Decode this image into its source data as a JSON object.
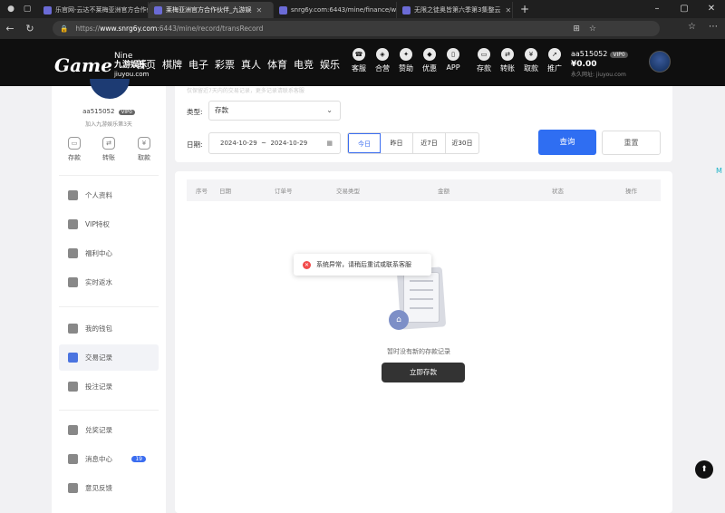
{
  "browser": {
    "tabs": [
      {
        "title": "乐官网-云达不莱梅亚洲官方合作伙"
      },
      {
        "title": "莱梅亚洲官方合作伙伴_九游娱"
      },
      {
        "title": "snrg6y.com:6443/mine/finance/w"
      },
      {
        "title": "无限之徒奥皆第六季第3集整云"
      }
    ],
    "url_prefix": "https://",
    "url_host": "www.snrg6y.com",
    "url_path": ":6443/mine/record/transRecord"
  },
  "header": {
    "logo_main": "Game",
    "logo_top": "Nine",
    "logo_cn": "九游娱乐",
    "logo_domain": "jiuyou.com",
    "nav": [
      "首页",
      "棋牌",
      "电子",
      "彩票",
      "真人",
      "体育",
      "电竞",
      "娱乐"
    ],
    "icons": [
      {
        "label": "客服",
        "icon": "headset-icon"
      },
      {
        "label": "合营",
        "icon": "partner-icon"
      },
      {
        "label": "赞助",
        "icon": "sponsor-icon"
      },
      {
        "label": "优惠",
        "icon": "gift-icon"
      },
      {
        "label": "APP",
        "icon": "phone-icon"
      },
      {
        "label": "存款",
        "icon": "wallet-icon"
      },
      {
        "label": "转账",
        "icon": "transfer-icon"
      },
      {
        "label": "取款",
        "icon": "withdraw-icon"
      },
      {
        "label": "推广",
        "icon": "promote-icon"
      }
    ],
    "username": "aa515052",
    "vip": "VIP0",
    "balance": "¥0.00",
    "permanent_site": "永久网址: jiuyou.com"
  },
  "sidebar": {
    "username": "aa515052",
    "vip": "VIP0",
    "joined": "加入九游娱乐第3天",
    "quick": [
      "存款",
      "转账",
      "取款"
    ],
    "items": [
      {
        "label": "个人资料",
        "icon": "profile-icon"
      },
      {
        "label": "VIP特权",
        "icon": "vip-icon"
      },
      {
        "label": "福利中心",
        "icon": "gift-icon"
      },
      {
        "label": "实时返水",
        "icon": "rebate-icon"
      },
      {
        "label": "我的钱包",
        "icon": "wallet-icon"
      },
      {
        "label": "交易记录",
        "icon": "transaction-icon"
      },
      {
        "label": "投注记录",
        "icon": "bet-record-icon"
      },
      {
        "label": "兑奖记录",
        "icon": "prize-icon"
      },
      {
        "label": "消息中心",
        "icon": "message-icon",
        "badge": "19"
      },
      {
        "label": "意见反馈",
        "icon": "feedback-icon"
      }
    ],
    "active_item": "交易记录"
  },
  "filters": {
    "faint_note": "仅保留近7天内的交易记录，更多记录请联系客服",
    "type_label": "类型:",
    "type_value": "存款",
    "date_label": "日期:",
    "date_start": "2024-10-29",
    "date_sep": "~",
    "date_end": "2024-10-29",
    "quick_ranges": [
      "今日",
      "昨日",
      "近7日",
      "近30日"
    ],
    "active_range": "今日",
    "query_label": "查询",
    "reset_label": "重置"
  },
  "table": {
    "columns": [
      "序号",
      "日期",
      "订单号",
      "交易类型",
      "金额",
      "状态",
      "操作"
    ]
  },
  "toast": {
    "message": "系统异常，请稍后重试或联系客服"
  },
  "empty": {
    "message": "暂时没有新的存款记录",
    "button": "立即存款"
  }
}
